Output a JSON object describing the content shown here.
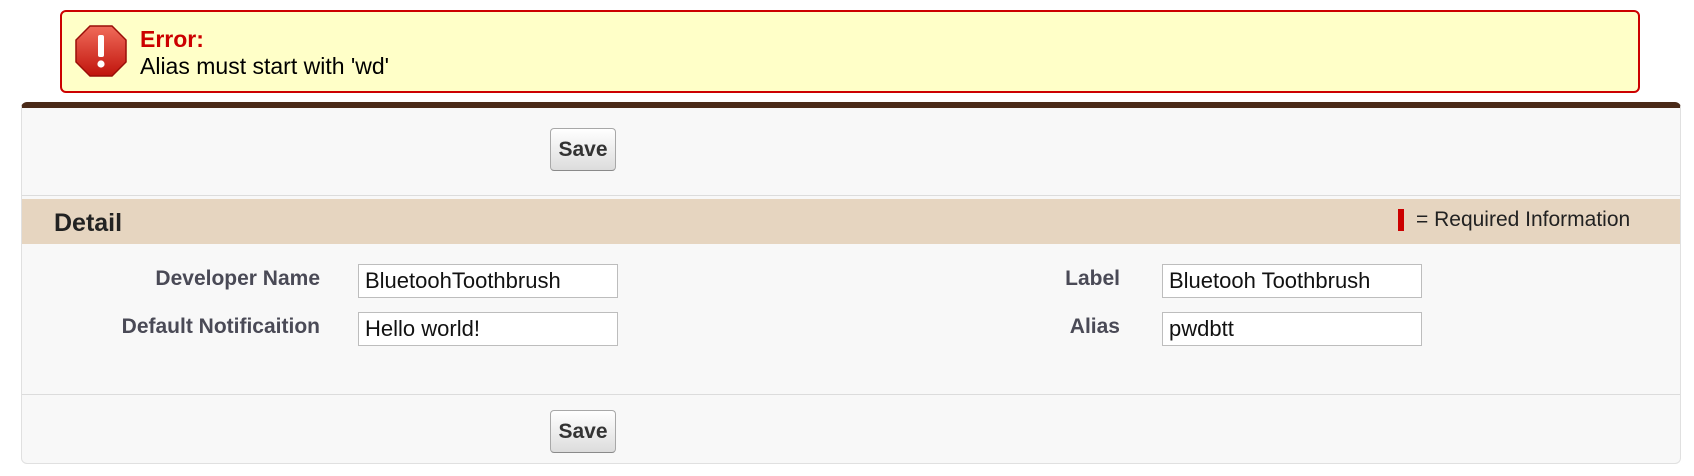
{
  "error": {
    "title": "Error:",
    "message": "Alias must start with 'wd'",
    "icon": "error-octagon-icon",
    "color": "#cc0000",
    "background": "#ffffc8"
  },
  "buttons": {
    "save_top": "Save",
    "save_bottom": "Save"
  },
  "section": {
    "title": "Detail",
    "required_legend": "= Required Information",
    "header_color": "#e6d5c0"
  },
  "fields": {
    "developer_name": {
      "label": "Developer Name",
      "value": "BluetoohToothbrush"
    },
    "default_notification": {
      "label": "Default Notificaition",
      "value": "Hello world!"
    },
    "label": {
      "label": "Label",
      "value": "Bluetooh Toothbrush"
    },
    "alias": {
      "label": "Alias",
      "value": "pwdbtt"
    }
  }
}
